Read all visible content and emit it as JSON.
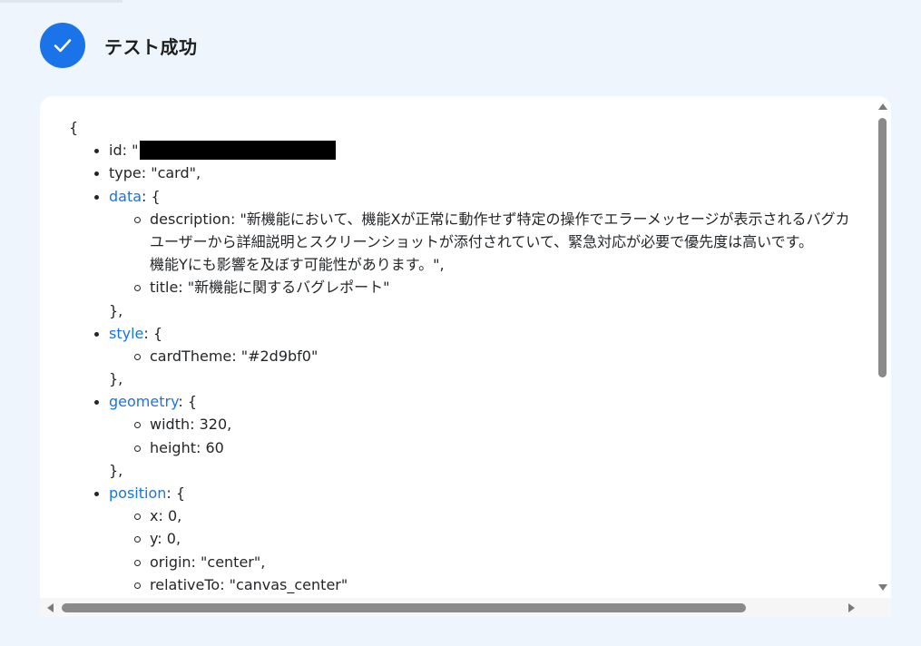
{
  "header": {
    "title": "テスト成功",
    "status_icon": "check-icon",
    "accent_color": "#1a73e8"
  },
  "json_view": {
    "open_brace": "{",
    "id_line": "id: \"",
    "type_line": "type: \"card\",",
    "data_key": "data",
    "data_open": ": {",
    "description_line1": "description: \"新機能において、機能Xが正常に動作せず特定の操作でエラーメッセージが表示されるバグカ",
    "description_line2": "ユーザーから詳細説明とスクリーンショットが添付されていて、緊急対応が必要で優先度は高いです。",
    "description_line3": "機能Yにも影響を及ぼす可能性があります。\",",
    "title_line": "title: \"新機能に関するバグレポート\"",
    "close_1": "},",
    "style_key": "style",
    "style_open": ": {",
    "card_theme_line": "cardTheme: \"#2d9bf0\"",
    "close_2": "},",
    "geometry_key": "geometry",
    "geometry_open": ": {",
    "width_line": "width: 320,",
    "height_line": "height: 60",
    "close_3": "},",
    "position_key": "position",
    "position_open": ": {",
    "x_line": "x: 0,",
    "y_line": "y: 0,",
    "origin_line": "origin: \"center\",",
    "relative_line": "relativeTo: \"canvas_center\""
  }
}
